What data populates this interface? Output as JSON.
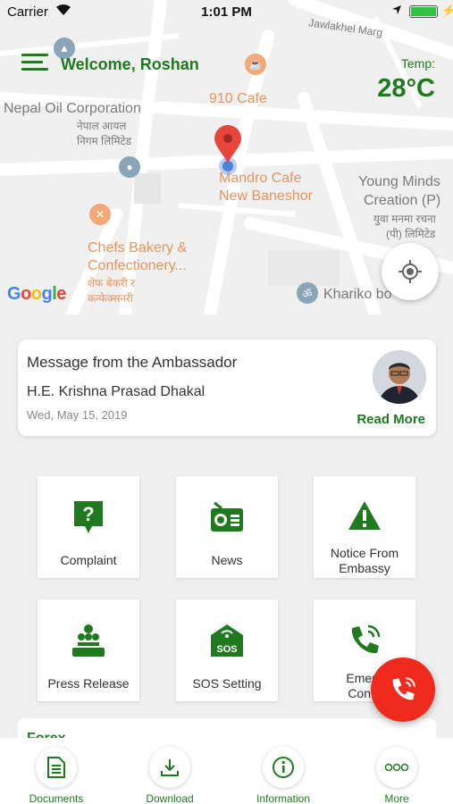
{
  "status_bar": {
    "carrier": "Carrier",
    "time": "1:01 PM"
  },
  "header": {
    "welcome": "Welcome, Roshan",
    "temp_label": "Temp:",
    "temp_value": "28°C"
  },
  "map": {
    "labels": {
      "road": "Jawlakhel Marg",
      "nepal_oil": "Nepal Oil Corporation",
      "nepal_oil_np1": "नेपाल आयल",
      "nepal_oil_np2": "निगम लिमिटेड",
      "cafe910": "910 Cafe",
      "mandro1": "Mandro Cafe",
      "mandro2": "New Baneshor",
      "young1": "Young Minds",
      "young2": "Creation (P)",
      "young_np1": "युवा मनमा रचना",
      "young_np2": "(पी) लिमिटेड",
      "chefs1": "Chefs Bakery &",
      "chefs2": "Confectionery...",
      "chefs_np1": "शेफ बेकरी र",
      "chefs_np2": "कन्फेक्सनरी",
      "khariko": "Khariko bo"
    },
    "google_logo": "Google"
  },
  "ambassador": {
    "title": "Message from the Ambassador",
    "name": "H.E. Krishna Prasad Dhakal",
    "date": "Wed, May 15, 2019",
    "read_more": "Read More"
  },
  "tiles": [
    {
      "label": "Complaint",
      "icon": "complaint-icon"
    },
    {
      "label": "News",
      "icon": "news-radio-icon"
    },
    {
      "label": "Notice From Embassy",
      "line1": "Notice From",
      "line2": "Embassy",
      "icon": "warning-icon"
    },
    {
      "label": "Press Release",
      "icon": "press-release-icon"
    },
    {
      "label": "SOS Setting",
      "icon": "sos-icon"
    },
    {
      "label": "Emergency Contact",
      "line1": "Emerg",
      "line2": "Conta",
      "icon": "phone-icon"
    }
  ],
  "forex": {
    "label": "Forex"
  },
  "bottom_nav": [
    {
      "label": "Documents",
      "icon": "document-icon"
    },
    {
      "label": "Download",
      "icon": "download-icon"
    },
    {
      "label": "Information",
      "icon": "info-icon"
    },
    {
      "label": "More",
      "icon": "more-icon"
    }
  ],
  "colors": {
    "brand_green": "#1f7a1f",
    "sos_red": "#f02a1c",
    "map_bg": "#f0f0f0"
  }
}
